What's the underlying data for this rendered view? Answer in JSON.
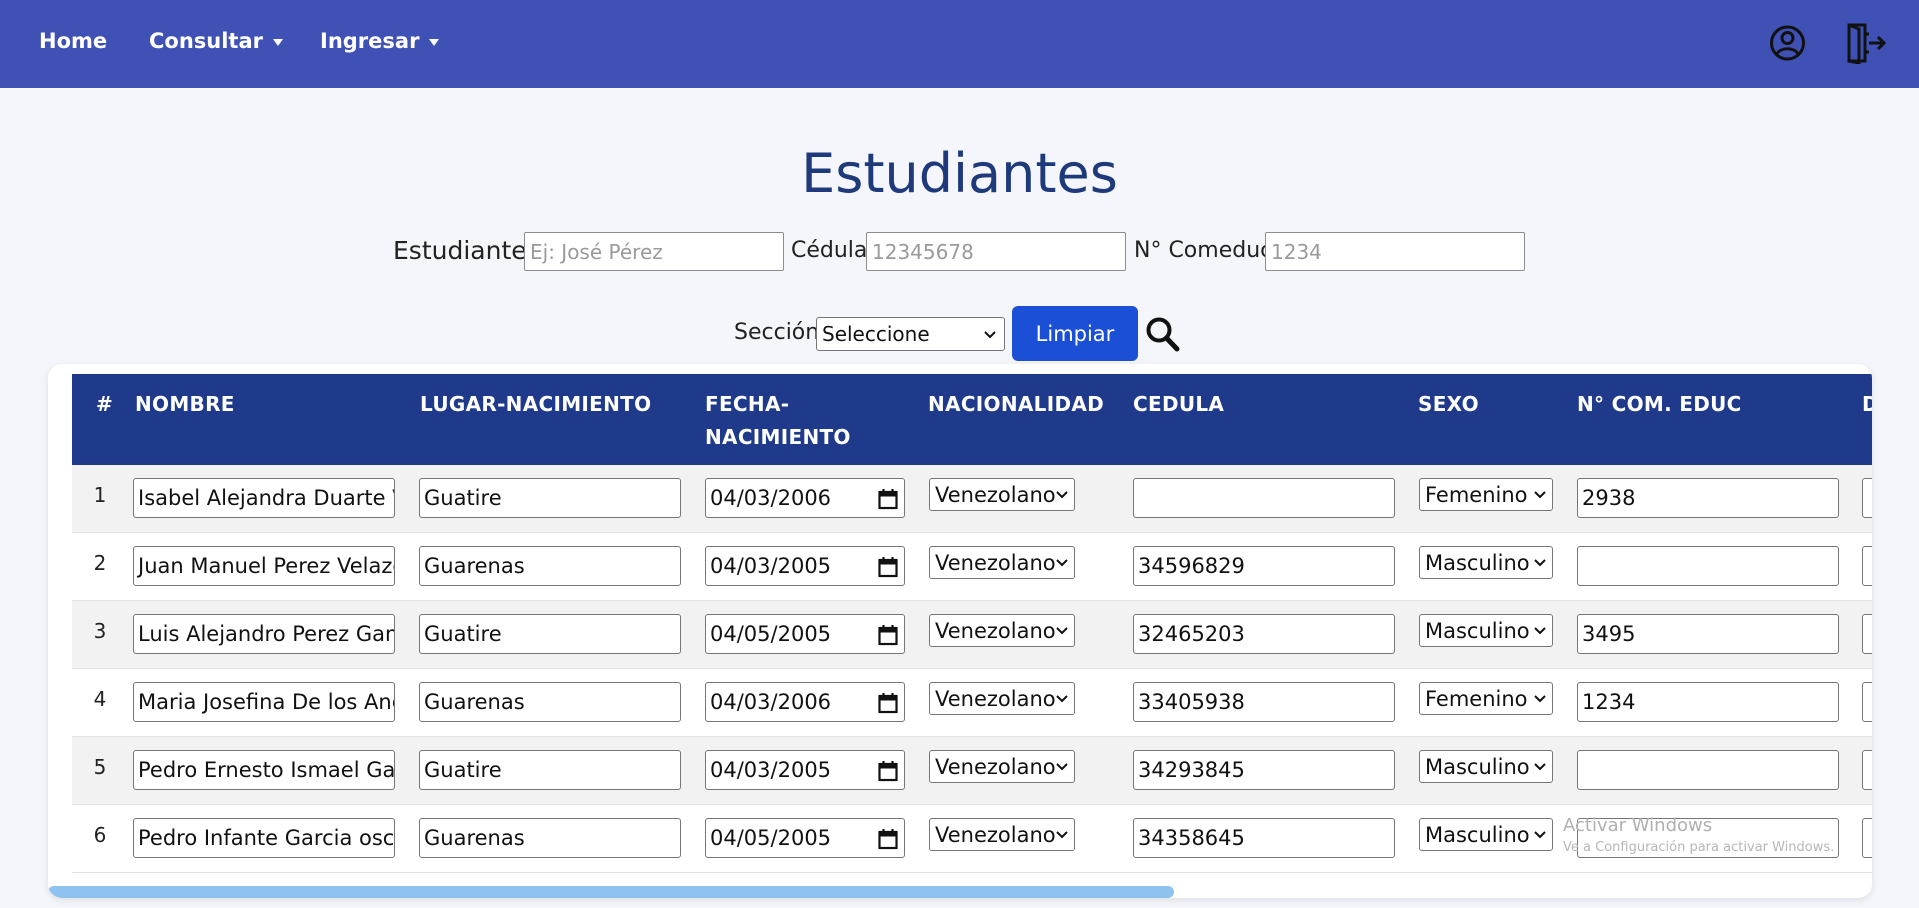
{
  "nav": {
    "home": "Home",
    "consultar": "Consultar",
    "ingresar": "Ingresar",
    "icons": [
      "user-circle-icon",
      "logout-icon"
    ],
    "background": "#3f51b5"
  },
  "page": {
    "title": "Estudiantes"
  },
  "filters": {
    "estudiante_label": "Estudiante",
    "estudiante_placeholder": "Ej: José Pérez",
    "cedula_label": "Cédula",
    "cedula_placeholder": "12345678",
    "comeduc_label": "N° Comeduc",
    "comeduc_placeholder": "1234",
    "seccion_label": "Sección",
    "seccion_value": "Seleccione",
    "limpiar_label": "Limpiar",
    "accent": "#1b4fd6"
  },
  "table": {
    "headers": {
      "num": "#",
      "nombre": "NOMBRE",
      "lugar": "LUGAR-NACIMIENTO",
      "fecha_1": "FECHA-",
      "fecha_2": "NACIMIENTO",
      "nacionalidad": "NACIONALIDAD",
      "cedula": "CEDULA",
      "sexo": "SEXO",
      "comeduc": "N° COM. EDUC",
      "cut": "D"
    },
    "header_color": "#1f3a8a",
    "rows": [
      {
        "n": "1",
        "nombre": "Isabel Alejandra Duarte Va",
        "lugar": "Guatire",
        "fecha": "04/03/2006",
        "nacionalidad": "Venezolano",
        "cedula": "",
        "sexo": "Femenino",
        "comeduc": "2938"
      },
      {
        "n": "2",
        "nombre": "Juan Manuel Perez Velazq",
        "lugar": "Guarenas",
        "fecha": "04/03/2005",
        "nacionalidad": "Venezolano",
        "cedula": "34596829",
        "sexo": "Masculino",
        "comeduc": ""
      },
      {
        "n": "3",
        "nombre": "Luis Alejandro Perez Gaml",
        "lugar": "Guatire",
        "fecha": "04/05/2005",
        "nacionalidad": "Venezolano",
        "cedula": "32465203",
        "sexo": "Masculino",
        "comeduc": "3495"
      },
      {
        "n": "4",
        "nombre": "Maria Josefina De los Ang",
        "lugar": "Guarenas",
        "fecha": "04/03/2006",
        "nacionalidad": "Venezolano",
        "cedula": "33405938",
        "sexo": "Femenino",
        "comeduc": "1234"
      },
      {
        "n": "5",
        "nombre": "Pedro Ernesto Ismael Garc",
        "lugar": "Guatire",
        "fecha": "04/03/2005",
        "nacionalidad": "Venezolano",
        "cedula": "34293845",
        "sexo": "Masculino",
        "comeduc": ""
      },
      {
        "n": "6",
        "nombre": "Pedro Infante Garcia oscar",
        "lugar": "Guarenas",
        "fecha": "04/05/2005",
        "nacionalidad": "Venezolano",
        "cedula": "34358645",
        "sexo": "Masculino",
        "comeduc": ""
      }
    ]
  },
  "watermark": {
    "line1": "Activar Windows",
    "line2": "Ve a Configuración para activar Windows."
  }
}
